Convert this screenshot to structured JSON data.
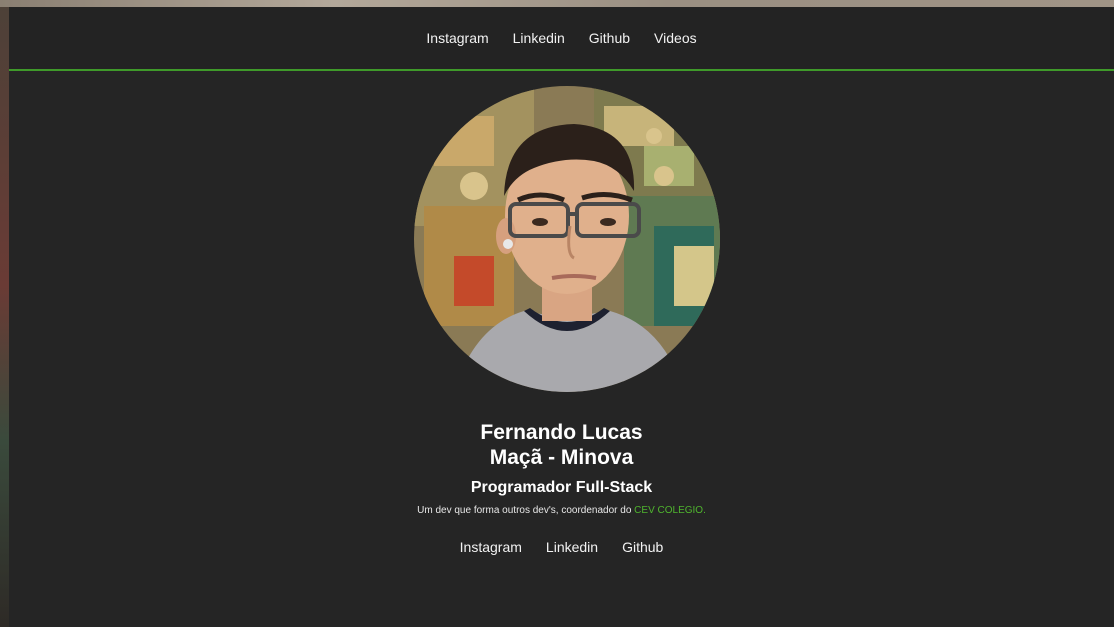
{
  "nav": {
    "items": [
      {
        "label": "Instagram"
      },
      {
        "label": "Linkedin"
      },
      {
        "label": "Github"
      },
      {
        "label": "Videos"
      }
    ]
  },
  "profile": {
    "name_line1": "Fernando Lucas",
    "name_line2": "Maçã - Minova",
    "role": "Programador Full-Stack",
    "bio_prefix": "Um dev que forma outros dev's, coordenador do ",
    "bio_highlight": "CEV COLEGIO."
  },
  "social": {
    "items": [
      {
        "label": "Instagram"
      },
      {
        "label": "Linkedin"
      },
      {
        "label": "Github"
      }
    ]
  },
  "colors": {
    "background": "#252525",
    "accent": "#3f9a2a",
    "highlight_text": "#4fb52e"
  }
}
